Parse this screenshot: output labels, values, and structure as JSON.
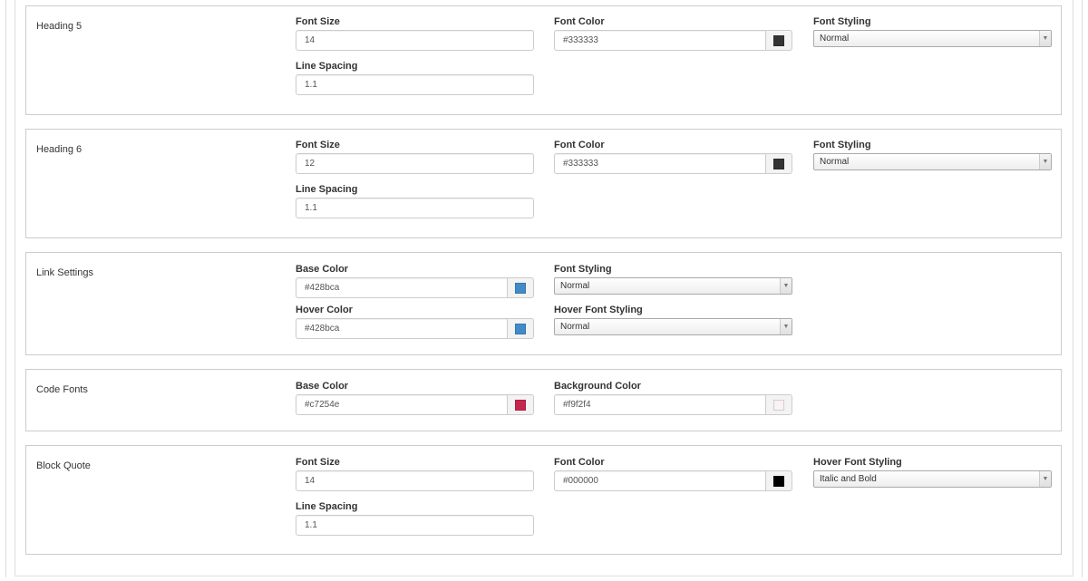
{
  "sections": [
    {
      "title": "Heading 5",
      "font_size": {
        "label": "Font Size",
        "value": "14"
      },
      "line_spacing": {
        "label": "Line Spacing",
        "value": "1.1"
      },
      "font_color": {
        "label": "Font Color",
        "value": "#333333",
        "swatch": "#333333"
      },
      "font_styling": {
        "label": "Font Styling",
        "value": "Normal"
      }
    },
    {
      "title": "Heading 6",
      "font_size": {
        "label": "Font Size",
        "value": "12"
      },
      "line_spacing": {
        "label": "Line Spacing",
        "value": "1.1"
      },
      "font_color": {
        "label": "Font Color",
        "value": "#333333",
        "swatch": "#333333"
      },
      "font_styling": {
        "label": "Font Styling",
        "value": "Normal"
      }
    },
    {
      "title": "Link Settings",
      "base_color": {
        "label": "Base Color",
        "value": "#428bca",
        "swatch": "#428bca"
      },
      "hover_color": {
        "label": "Hover Color",
        "value": "#428bca",
        "swatch": "#428bca"
      },
      "font_styling": {
        "label": "Font Styling",
        "value": "Normal"
      },
      "hover_font_styling": {
        "label": "Hover Font Styling",
        "value": "Normal"
      }
    },
    {
      "title": "Code Fonts",
      "base_color": {
        "label": "Base Color",
        "value": "#c7254e",
        "swatch": "#c7254e"
      },
      "background_color": {
        "label": "Background Color",
        "value": "#f9f2f4",
        "swatch": "#f9f2f4"
      }
    },
    {
      "title": "Block Quote",
      "font_size": {
        "label": "Font Size",
        "value": "14"
      },
      "line_spacing": {
        "label": "Line Spacing",
        "value": "1.1"
      },
      "font_color": {
        "label": "Font Color",
        "value": "#000000",
        "swatch": "#000000"
      },
      "hover_font_styling": {
        "label": "Hover Font Styling",
        "value": "Italic and Bold"
      }
    }
  ]
}
